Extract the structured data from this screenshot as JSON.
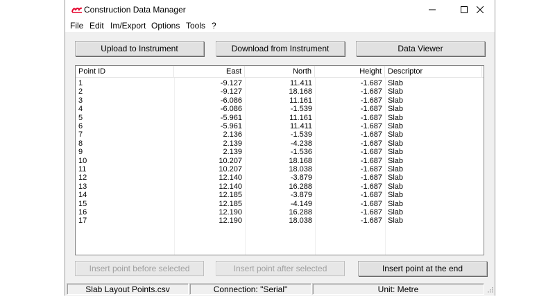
{
  "window": {
    "title": "Construction Data Manager",
    "logo_color": "#e4002b"
  },
  "menu": [
    "File",
    "Edit",
    "Im/Export",
    "Options",
    "Tools",
    "?"
  ],
  "toolbar": {
    "upload_label": "Upload to Instrument",
    "download_label": "Download from Instrument",
    "viewer_label": "Data Viewer"
  },
  "table": {
    "columns": [
      "Point ID",
      "East",
      "North",
      "Height",
      "Descriptor"
    ],
    "rows": [
      [
        "1",
        "-9.127",
        "11.411",
        "-1.687",
        "Slab"
      ],
      [
        "2",
        "-9.127",
        "18.168",
        "-1.687",
        "Slab"
      ],
      [
        "3",
        "-6.086",
        "11.161",
        "-1.687",
        "Slab"
      ],
      [
        "4",
        "-6.086",
        "-1.539",
        "-1.687",
        "Slab"
      ],
      [
        "5",
        "-5.961",
        "11.161",
        "-1.687",
        "Slab"
      ],
      [
        "6",
        "-5.961",
        "11.411",
        "-1.687",
        "Slab"
      ],
      [
        "7",
        "2.136",
        "-1.539",
        "-1.687",
        "Slab"
      ],
      [
        "8",
        "2.139",
        "-4.238",
        "-1.687",
        "Slab"
      ],
      [
        "9",
        "2.139",
        "-1.536",
        "-1.687",
        "Slab"
      ],
      [
        "10",
        "10.207",
        "18.168",
        "-1.687",
        "Slab"
      ],
      [
        "11",
        "10.207",
        "18.038",
        "-1.687",
        "Slab"
      ],
      [
        "12",
        "12.140",
        "-3.879",
        "-1.687",
        "Slab"
      ],
      [
        "13",
        "12.140",
        "16.288",
        "-1.687",
        "Slab"
      ],
      [
        "14",
        "12.185",
        "-3.879",
        "-1.687",
        "Slab"
      ],
      [
        "15",
        "12.185",
        "-4.149",
        "-1.687",
        "Slab"
      ],
      [
        "16",
        "12.190",
        "16.288",
        "-1.687",
        "Slab"
      ],
      [
        "17",
        "12.190",
        "18.038",
        "-1.687",
        "Slab"
      ]
    ]
  },
  "actions": {
    "insert_before_label": "Insert point before selected",
    "insert_after_label": "Insert point after selected",
    "insert_end_label": "Insert point at the end"
  },
  "status": {
    "file": "Slab Layout Points.csv",
    "connection": "Connection: \"Serial\"",
    "unit": "Unit: Metre"
  }
}
